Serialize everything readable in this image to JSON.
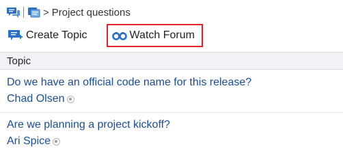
{
  "breadcrumb": {
    "forum_icon": "discussion-bubbles-icon",
    "board_icon": "discussion-board-icon",
    "separator": ">",
    "current": "Project questions"
  },
  "toolbar": {
    "create_label": "Create Topic",
    "create_icon": "create-topic-icon",
    "watch_label": "Watch Forum",
    "watch_icon": "binoculars-icon",
    "highlight_color": "#e0242b"
  },
  "table": {
    "header": "Topic",
    "rows": [
      {
        "title": "Do we have an official code name for this release?",
        "author": "Chad Olsen"
      },
      {
        "title": "Are we planning a project kickoff?",
        "author": "Ari Spice"
      }
    ]
  },
  "colors": {
    "link": "#1a4e96",
    "icon_blue": "#2a6fc4"
  }
}
